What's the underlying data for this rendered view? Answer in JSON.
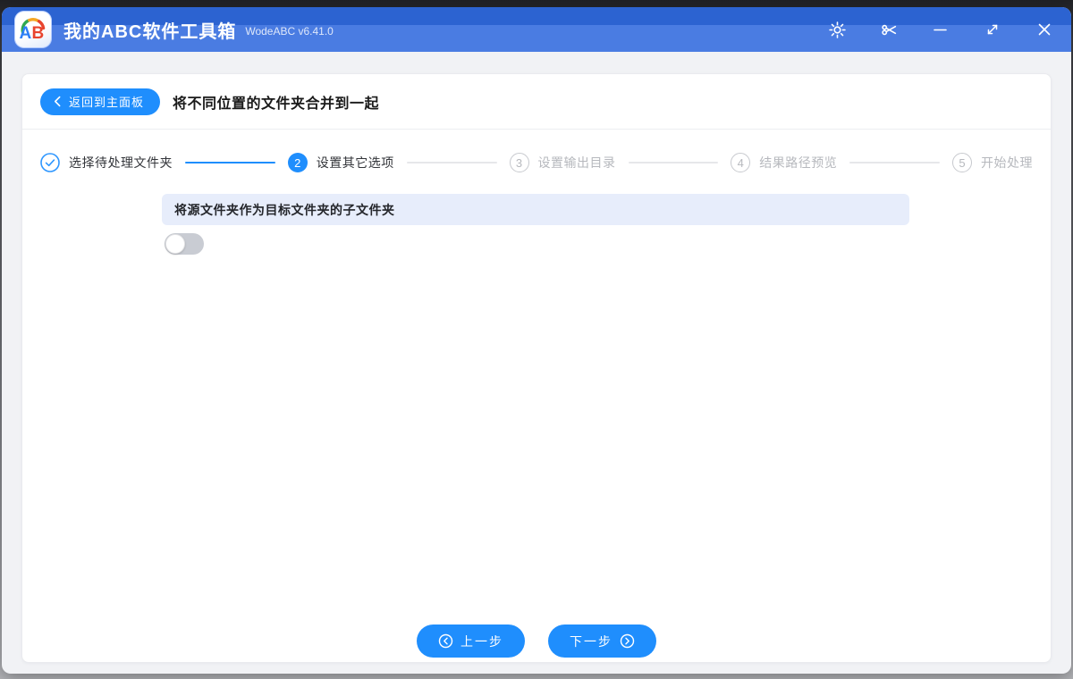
{
  "colors": {
    "accent": "#1f8efd",
    "titlebar_top": "#2c63d1",
    "titlebar_bottom": "#4a7ce2",
    "option_row_bg": "#e7edfb",
    "step_pending": "#c7c9ce"
  },
  "titlebar": {
    "logo_text": "AB",
    "app_title": "我的ABC软件工具箱",
    "version": "WodeABC v6.41.0",
    "icons": [
      "settings-icon",
      "scissors-icon",
      "minimize-icon",
      "resize-icon",
      "close-icon"
    ]
  },
  "header": {
    "back_button": "返回到主面板",
    "page_title": "将不同位置的文件夹合并到一起"
  },
  "steps": [
    {
      "num": "1",
      "label": "选择待处理文件夹",
      "state": "done"
    },
    {
      "num": "2",
      "label": "设置其它选项",
      "state": "current"
    },
    {
      "num": "3",
      "label": "设置输出目录",
      "state": "pending"
    },
    {
      "num": "4",
      "label": "结果路径预览",
      "state": "pending"
    },
    {
      "num": "5",
      "label": "开始处理",
      "state": "pending"
    }
  ],
  "options": [
    {
      "label": "将源文件夹作为目标文件夹的子文件夹",
      "enabled": false
    }
  ],
  "footer": {
    "prev": "上一步",
    "next": "下一步"
  }
}
